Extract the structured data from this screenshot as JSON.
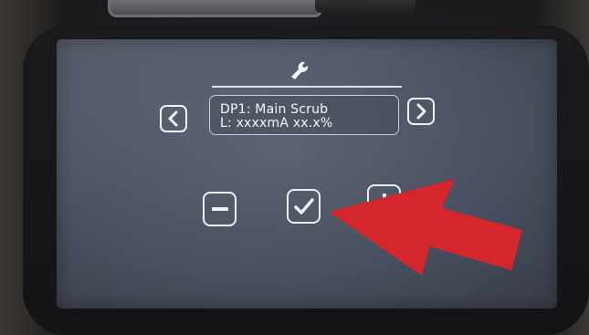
{
  "device": {
    "header_icon": "wrench-icon"
  },
  "display": {
    "line1": "DP1: Main Scrub",
    "line2": "L: xxxxmA  xx.x%"
  },
  "navigation": {
    "prev_icon": "chevron-left-icon",
    "next_icon": "chevron-right-icon"
  },
  "controls": {
    "decrease_icon": "minus-icon",
    "confirm_icon": "checkmark-icon",
    "increase_icon": "plus-icon"
  },
  "annotation": {
    "arrow_color": "#d3262d",
    "points_to": "confirm-button"
  },
  "colors": {
    "screen": "#4f5666",
    "ui_lines": "#f1f3f6"
  }
}
